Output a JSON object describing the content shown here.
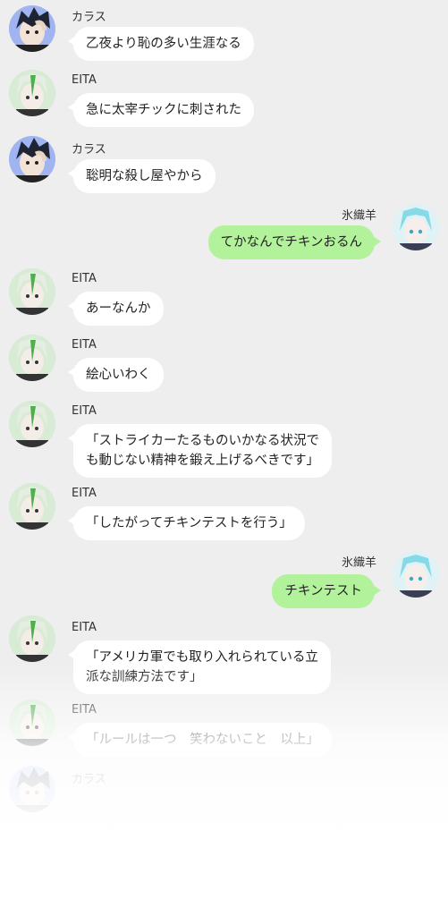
{
  "messages": [
    {
      "sender": "カラス",
      "text": "乙夜より恥の多い生涯なる",
      "side": "left",
      "avatar": "crow-avatar"
    },
    {
      "sender": "EITA",
      "text": "急に太宰チックに刺された",
      "side": "left",
      "avatar": "eita-avatar"
    },
    {
      "sender": "カラス",
      "text": "聡明な殺し屋やから",
      "side": "left",
      "avatar": "crow-avatar"
    },
    {
      "sender": "氷織羊",
      "text": "てかなんでチキンおるん",
      "side": "right",
      "avatar": "hiori-avatar"
    },
    {
      "sender": "EITA",
      "text": "あーなんか",
      "side": "left",
      "avatar": "eita-avatar"
    },
    {
      "sender": "EITA",
      "text": "絵心いわく",
      "side": "left",
      "avatar": "eita-avatar"
    },
    {
      "sender": "EITA",
      "text": "「ストライカーたるものいかなる状況で\nも動じない精神を鍛え上げるべきです」",
      "side": "left",
      "avatar": "eita-avatar"
    },
    {
      "sender": "EITA",
      "text": "「したがってチキンテストを行う」",
      "side": "left",
      "avatar": "eita-avatar"
    },
    {
      "sender": "氷織羊",
      "text": "チキンテスト",
      "side": "right",
      "avatar": "hiori-avatar"
    },
    {
      "sender": "EITA",
      "text": "「アメリカ軍でも取り入れられている立\n派な訓練方法です」",
      "side": "left",
      "avatar": "eita-avatar"
    },
    {
      "sender": "EITA",
      "text": "「ルールは一つ　笑わないこと　以上」",
      "side": "left",
      "avatar": "eita-avatar"
    },
    {
      "sender": "カラス",
      "text": "",
      "side": "left",
      "avatar": "crow-avatar"
    }
  ],
  "colors": {
    "background": "#eeeeee",
    "bubble_other": "#ffffff",
    "bubble_self": "#b2f29a"
  }
}
